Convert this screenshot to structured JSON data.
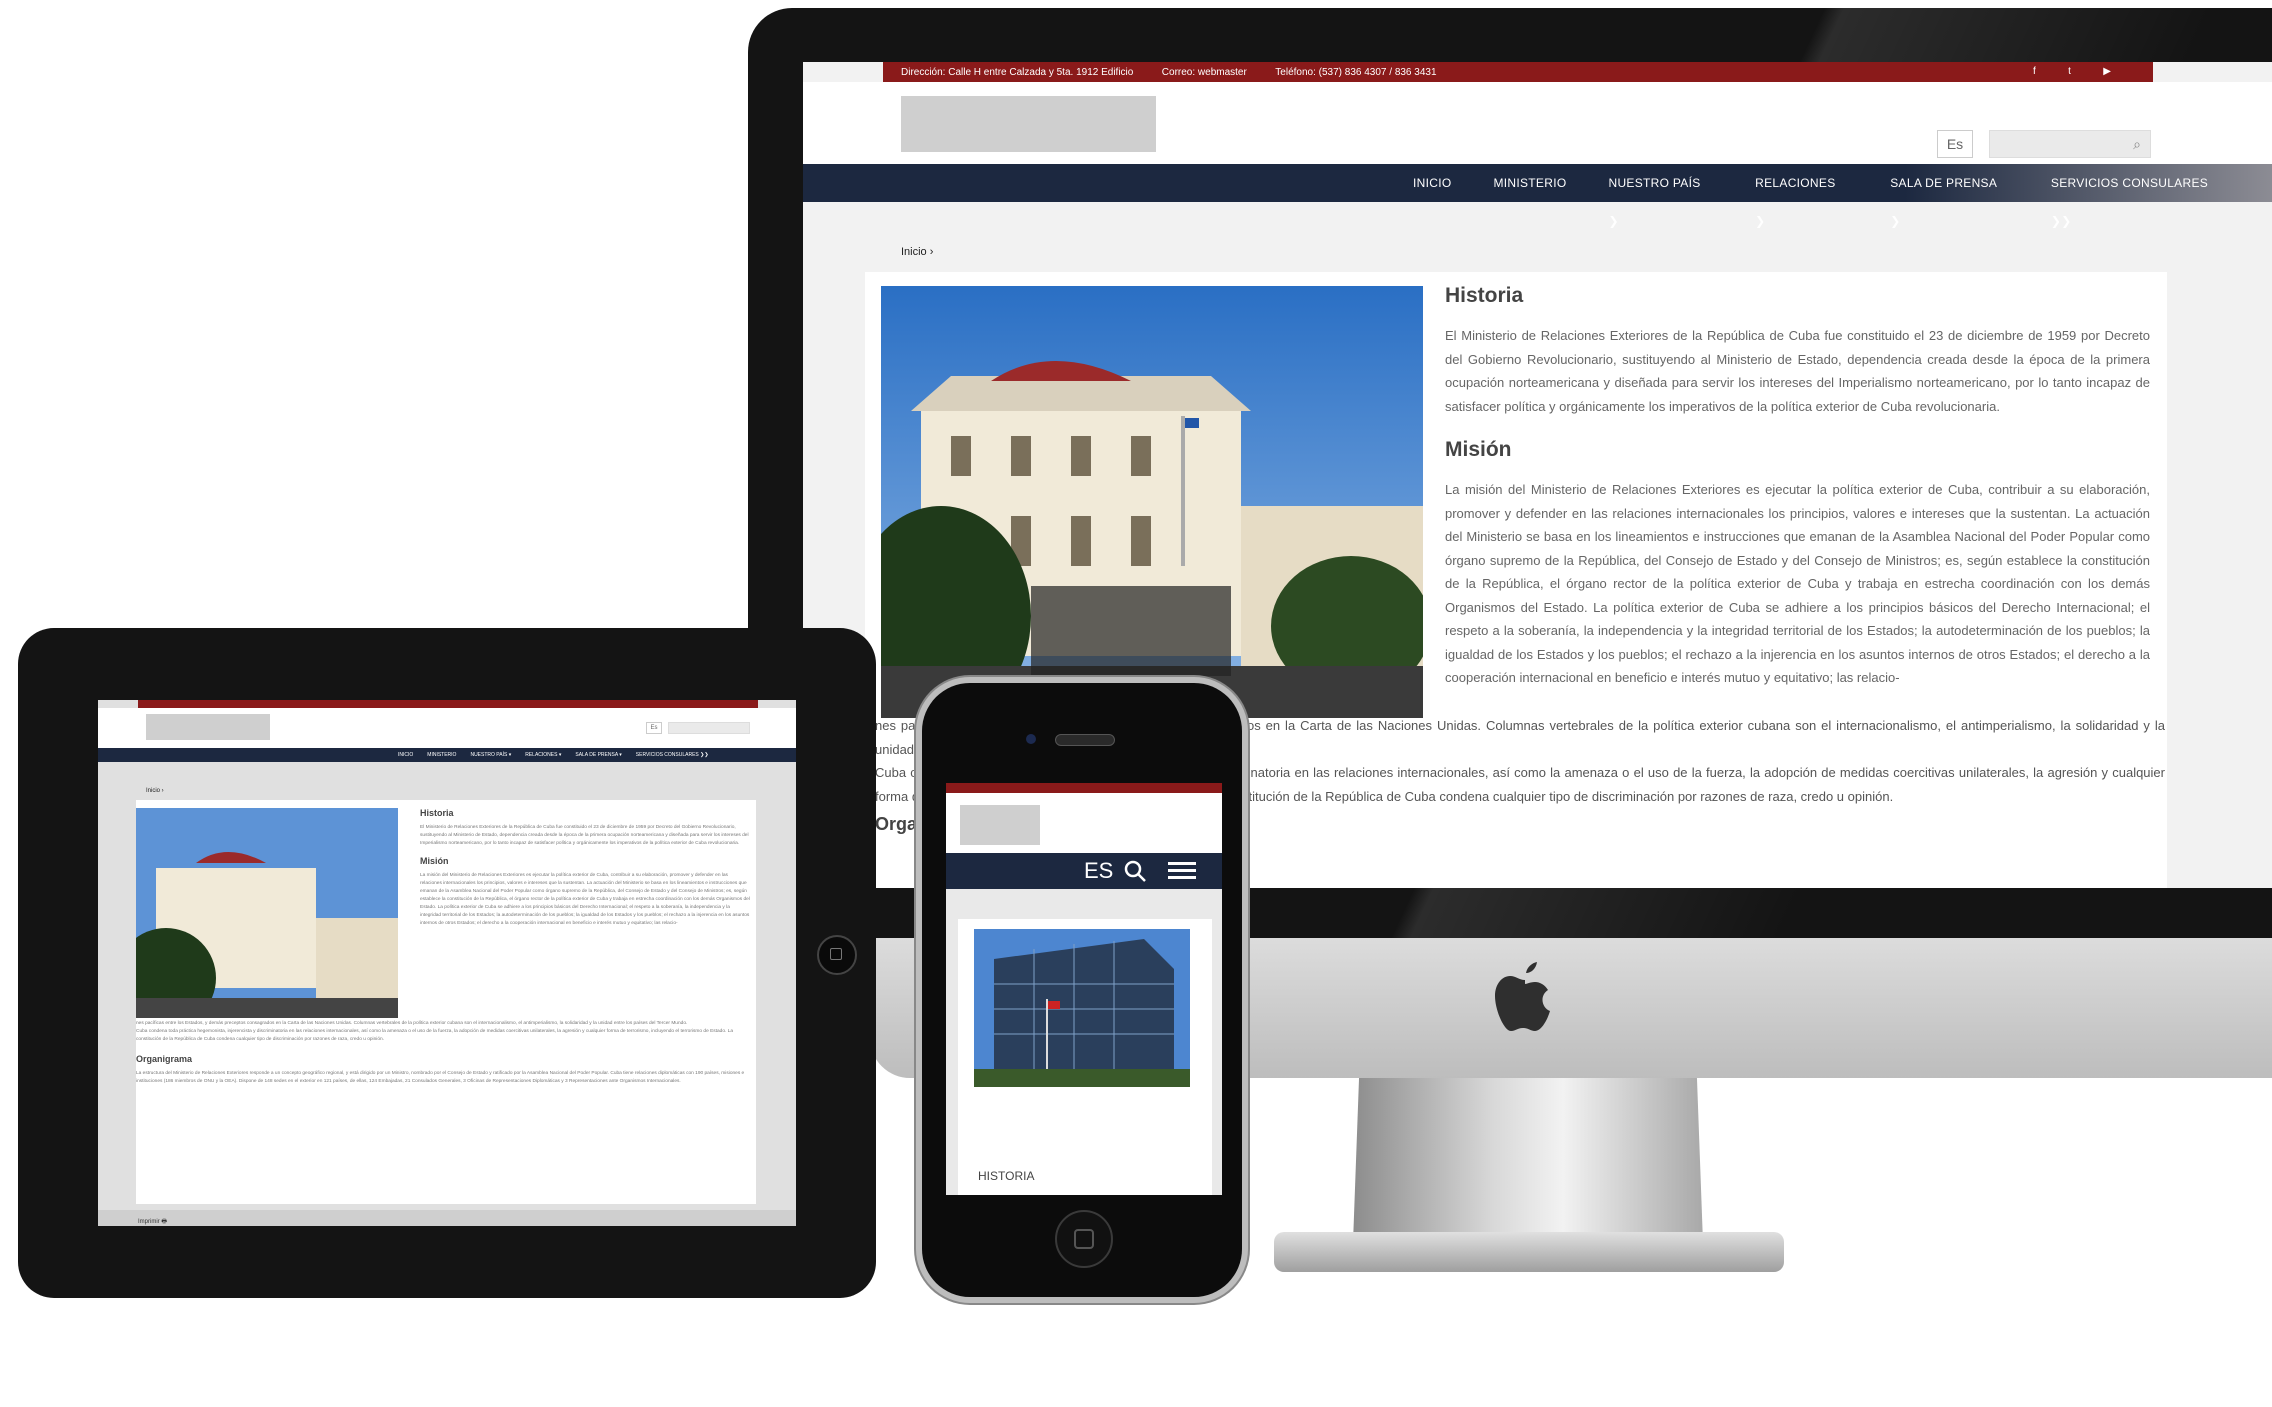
{
  "desktop": {
    "topbar": {
      "address": "Dirección: Calle H entre Calzada y 5ta. 1912 Edificio",
      "email": "Correo: webmaster",
      "phone": "Teléfono: (537) 836 4307 / 836 3431"
    },
    "header": {
      "lang": "Es"
    },
    "nav": [
      "INICIO",
      "MINISTERIO",
      "NUESTRO PAÍS ❯",
      "RELACIONES ❯",
      "SALA DE PRENSA ❯",
      "SERVICIOS CONSULARES ❯❯"
    ],
    "breadcrumb": "Inicio ›",
    "historia_title": "Historia",
    "historia_text": "El Ministerio de Relaciones Exteriores de la República de Cuba fue constituido el 23 de diciembre de 1959 por Decreto del Gobierno Revolucionario, sustituyendo al Ministerio de Estado, dependencia creada desde la época de la primera ocupación norteamericana y diseñada para servir los intereses del Imperialismo norteamericano, por lo tanto incapaz de satisfacer política y orgánicamente los imperativos de la política exterior de Cuba revolucionaria.",
    "mision_title": "Misión",
    "mision_text": "La misión del Ministerio de Relaciones Exteriores es ejecutar la política exterior de Cuba, contribuir a su elaboración, promover y defender en las relaciones internacionales los principios, valores e intereses que la sustentan. La actuación del Ministerio se basa en los lineamientos e instrucciones que emanan de la Asamblea Nacional del Poder Popular como órgano supremo de la República, del Consejo de Estado y del Consejo de Ministros; es, según establece la constitución de la República, el órgano rector de la política exterior de Cuba y trabaja en estrecha coordinación con los demás Organismos del Estado. La política exterior de Cuba se adhiere a los principios básicos del Derecho Internacional; el respeto a la soberanía, la independencia y la integridad territorial de los Estados; la autodeterminación de los pueblos; la igualdad de los Estados y los pueblos; el rechazo a la injerencia en los asuntos internos de otros Estados; el derecho a la cooperación internacional en beneficio e interés mutuo y equitativo; las relacio-",
    "overflow_text_1": "nes pacíficas entre los Estados, y demás preceptos consagrados en la Carta de las Naciones Unidas. Columnas vertebrales de la política exterior cubana son el internacionalismo, el antimperialismo, la solidaridad y la unidad entre los países del Tercer Mundo.",
    "overflow_text_2": "Cuba condena toda práctica hegemonista, injerencista y discriminatoria en las relaciones internacionales, así como la amenaza o el uso de la fuerza, la adopción de medidas coercitivas unilaterales, la agresión y cualquier forma de terrorismo, incluyendo el terrorismo de Estado. La constitución de la República de Cuba condena cualquier tipo de discriminación por razones de raza, credo u opinión.",
    "overflow_heading": "Organigrama"
  },
  "tablet": {
    "lang": "Es",
    "nav": [
      "INICIO",
      "MINISTERIO",
      "NUESTRO PAÍS ▾",
      "RELACIONES ▾",
      "SALA DE PRENSA ▾",
      "SERVICIOS CONSULARES ❯❯"
    ],
    "breadcrumb": "Inicio ›",
    "historia_title": "Historia",
    "mision_title": "Misión",
    "organigrama_title": "Organigrama",
    "organigrama_text": "La estructura del Ministerio de Relaciones Exteriores responde a un concepto geográfico regional, y está dirigido por un Ministro, nombrado por el Consejo de Estado y ratificado por la Asamblea Nacional del Poder Popular. Cuba tiene relaciones diplomáticas con 190 países, misiones e instituciones (186 miembros de ONU y la OEA). Dispone de 148 sedes en el exterior en 121 países, de ellas, 124 Embajadas, 21 Consulados Generales, 3 Oficinas de Representaciones Diplomáticas y 3 Representaciones ante Organismos Internacionales.",
    "footer": "Imprimir 🖶"
  },
  "phone": {
    "lang": "ES",
    "section_label": "HISTORIA"
  },
  "colors": {
    "topbar": "#8a1a1a",
    "nav": "#1c2840",
    "device": "#141414"
  }
}
